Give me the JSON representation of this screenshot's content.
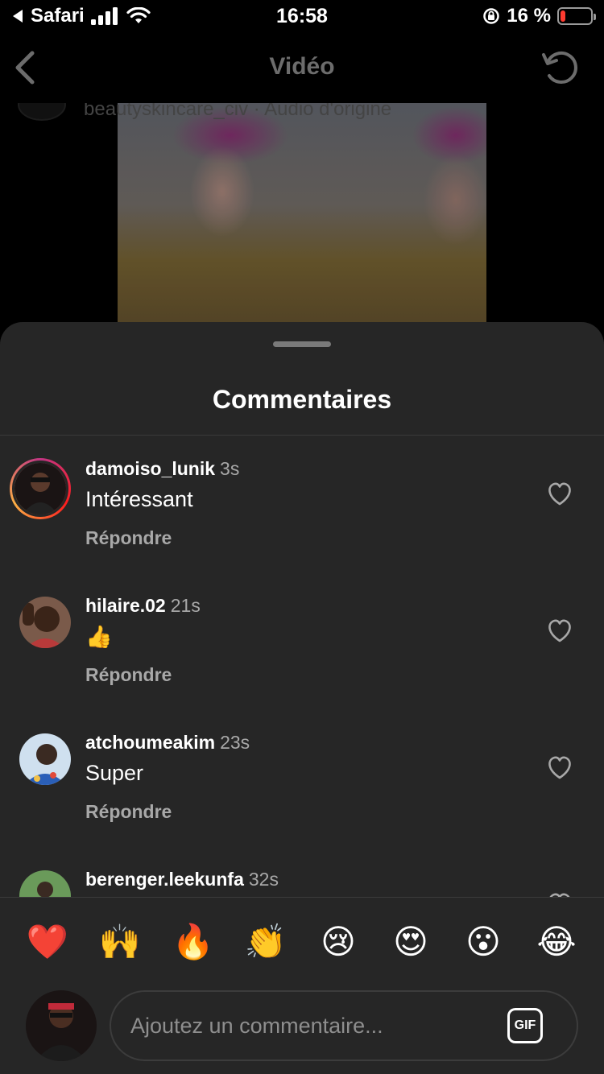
{
  "status_bar": {
    "back_app": "Safari",
    "time": "16:58",
    "battery_text": "16 %",
    "battery_level": 0.16,
    "battery_color": "#ff3b30"
  },
  "nav": {
    "title": "Vidéo",
    "back_icon": "chevron-left-icon",
    "refresh_icon": "refresh-icon"
  },
  "video": {
    "author_line": "beautyskincare_civ · Audio d'origine"
  },
  "sheet": {
    "title": "Commentaires"
  },
  "comments": [
    {
      "username": "damoiso_lunik",
      "time": "3s",
      "text": "Intéressant",
      "reply_label": "Répondre"
    },
    {
      "username": "hilaire.02",
      "time": "21s",
      "text": "👍",
      "reply_label": "Répondre"
    },
    {
      "username": "atchoumeakim",
      "time": "23s",
      "text": "Super",
      "reply_label": "Répondre"
    },
    {
      "username": "berenger.leekunfa",
      "time": "32s",
      "text": "",
      "reply_label": ""
    }
  ],
  "emoji_reactions": [
    "❤️",
    "🙌",
    "🔥",
    "👏",
    "😢",
    "😍",
    "😮",
    "😂"
  ],
  "composer": {
    "placeholder": "Ajoutez un commentaire...",
    "gif_label": "GIF"
  },
  "colors": {
    "sheet_bg": "#262626",
    "secondary_text": "#a8a8a8",
    "nav_title": "#6c6c6c"
  }
}
